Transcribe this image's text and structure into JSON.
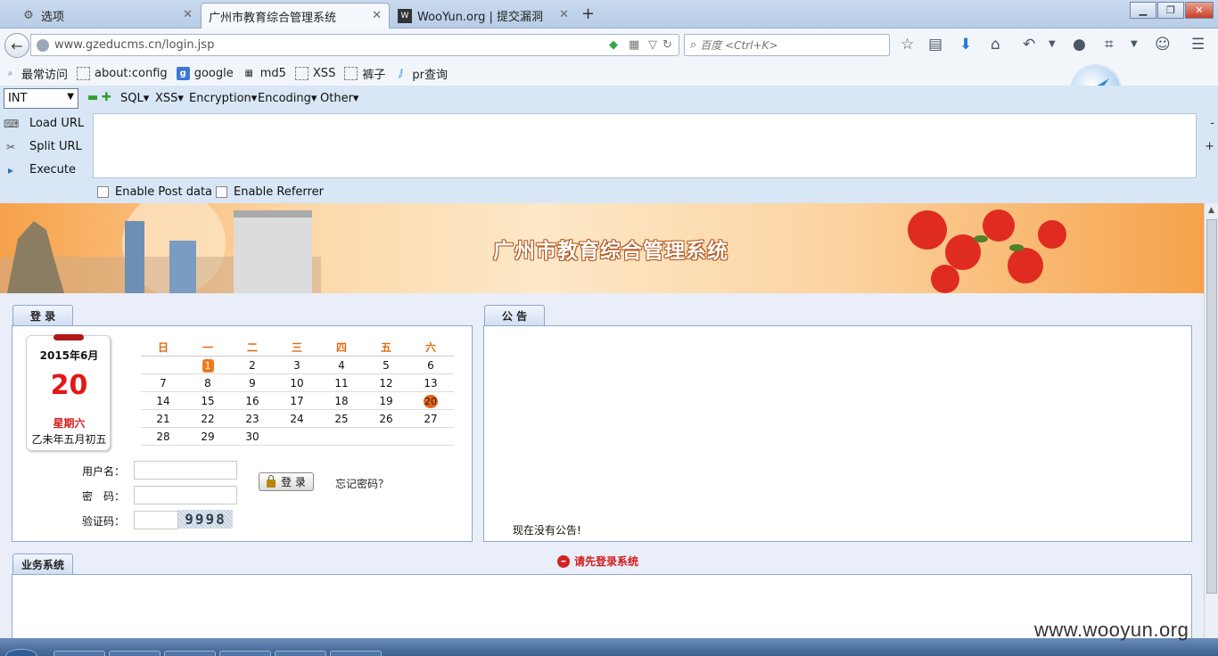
{
  "browser": {
    "tabs": [
      {
        "label": "选项",
        "active": false
      },
      {
        "label": "广州市教育综合管理系统",
        "active": true
      },
      {
        "label": "WooYun.org | 提交漏洞",
        "active": false
      }
    ],
    "url": "www.gzeducms.cn/login.jsp",
    "search_placeholder": "百度 <Ctrl+K>",
    "bookmarks": [
      "最常访问",
      "about:config",
      "google",
      "md5",
      "XSS",
      "裤子",
      "pr查询"
    ]
  },
  "hackbar": {
    "type_select": "INT",
    "menus": [
      "SQL▾",
      "XSS▾",
      "Encryption▾",
      "Encoding▾",
      "Other▾"
    ],
    "actions": [
      "Load URL",
      "Split URL",
      "Execute"
    ],
    "checks": [
      "Enable Post data",
      "Enable Referrer"
    ]
  },
  "site": {
    "title": "广州市教育综合管理系统",
    "login_tab": "登 录",
    "notice_tab": "公 告",
    "business_tab": "业务系统",
    "calendar": {
      "year_month": "2015年6月",
      "day": "20",
      "weekday": "星期六",
      "lunar": "乙未年五月初五",
      "headers": [
        "日",
        "一",
        "二",
        "三",
        "四",
        "五",
        "六"
      ],
      "rows": [
        [
          "",
          "1",
          "2",
          "3",
          "4",
          "5",
          "6"
        ],
        [
          "7",
          "8",
          "9",
          "10",
          "11",
          "12",
          "13"
        ],
        [
          "14",
          "15",
          "16",
          "17",
          "18",
          "19",
          "20"
        ],
        [
          "21",
          "22",
          "23",
          "24",
          "25",
          "26",
          "27"
        ],
        [
          "28",
          "29",
          "30",
          "",
          "",
          "",
          ""
        ]
      ]
    },
    "username_label": "用户名：",
    "password_label": "密　码：",
    "captcha_label": "验证码：",
    "captcha_text": "9998",
    "login_button": "登 录",
    "forgot_link": "忘记密码？",
    "notice_text": "现在没有公告!",
    "login_warning": "请先登录系统"
  },
  "watermark": "www.wooyun.org",
  "colors": {
    "accent_orange": "#f07a1c",
    "warning_red": "#d21c1c",
    "panel_border": "#8ea7cf"
  }
}
